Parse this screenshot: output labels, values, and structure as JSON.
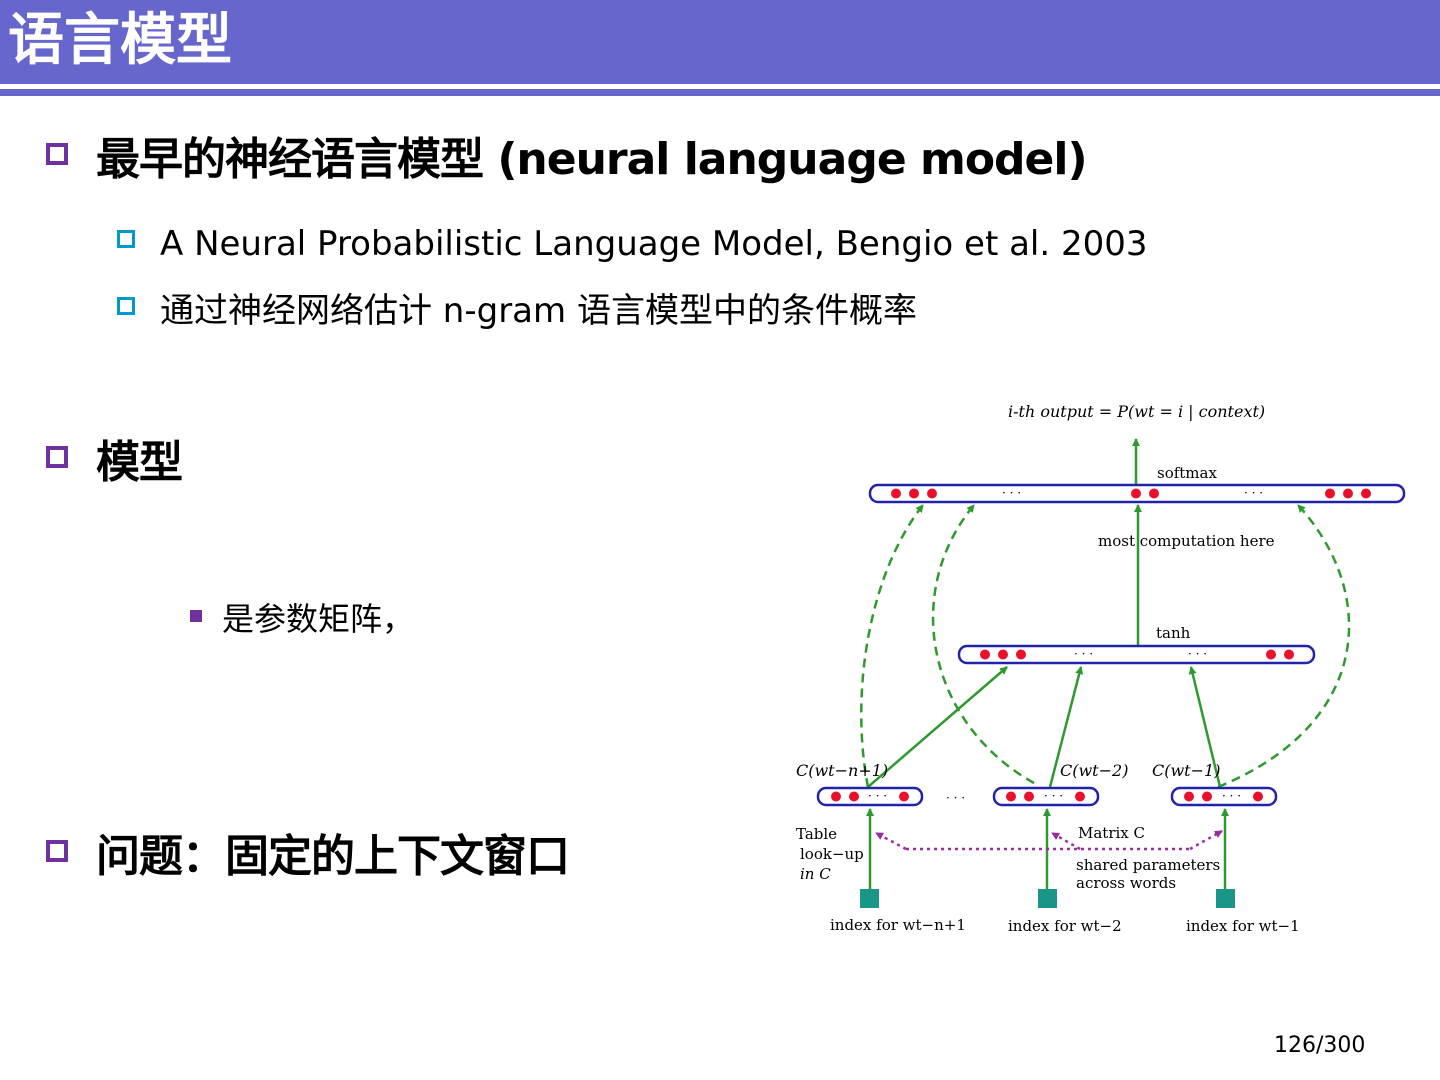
{
  "slide": {
    "title": "语言模型",
    "page_number": "126/300"
  },
  "content": {
    "bullet1": {
      "text": "最早的神经语言模型 (neural language model)",
      "sub": [
        "A Neural Probabilistic Language Model, Bengio et al. 2003",
        "通过神经网络估计 n-gram 语言模型中的条件概率"
      ]
    },
    "bullet2": {
      "text": "模型",
      "sub": [
        "是参数矩阵，"
      ]
    },
    "bullet3": {
      "text": "问题：固定的上下文窗口"
    }
  },
  "diagram": {
    "output_label": "i-th output = P(wt = i | context)",
    "softmax_label": "softmax",
    "computation_label": "most computation here",
    "tanh_label": "tanh",
    "ellipsis": "· · ·",
    "context_labels": [
      "C(wt−n+1)",
      "C(wt−2)",
      "C(wt−1)"
    ],
    "table_label": [
      "Table",
      "look−up",
      "in C"
    ],
    "matrix_label": "Matrix C",
    "shared_label": [
      "shared parameters",
      "across words"
    ],
    "index_labels": [
      "index for wt−n+1",
      "index for wt−2",
      "index for wt−1"
    ],
    "colors": {
      "box": "#2222aa",
      "node": "#e8102a",
      "arrow": "#2e9a2e",
      "dashed": "#2e9a2e",
      "shared": "#9a2ea0",
      "index": "#1a9688"
    }
  }
}
